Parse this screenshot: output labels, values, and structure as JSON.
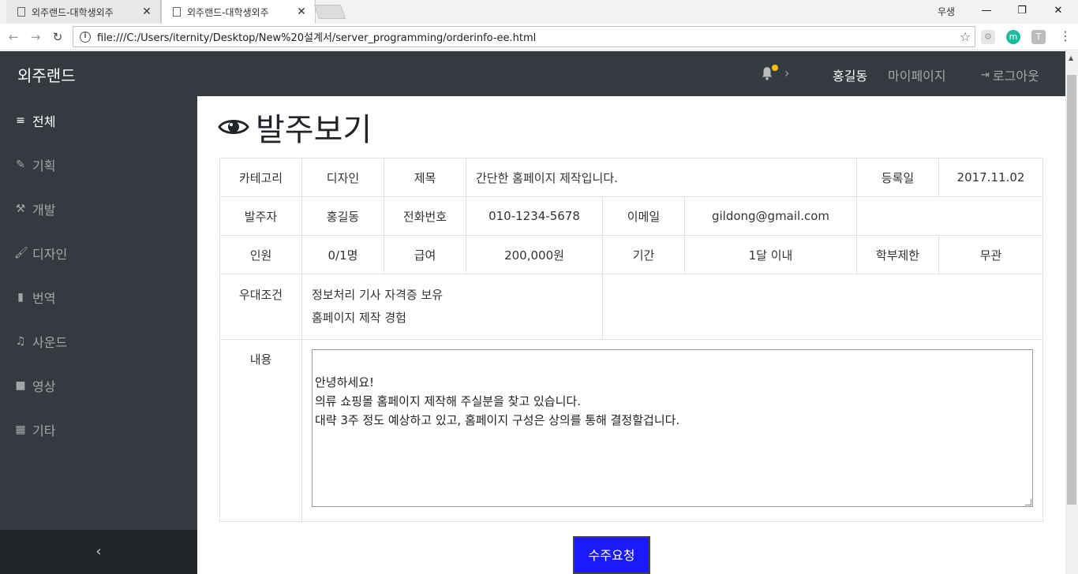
{
  "browser": {
    "tabs": [
      {
        "title": "외주랜드-대학생외주",
        "close": "✕"
      },
      {
        "title": "외주랜드-대학생외주",
        "close": "✕"
      }
    ],
    "profile": "우생",
    "window_controls": {
      "minimize": "—",
      "restore": "❐",
      "close": "✕"
    },
    "url": "file:///C:/Users/iternity/Desktop/New%20설계서/server_programming/orderinfo-ee.html",
    "extensions": [
      "m",
      "T"
    ]
  },
  "topbar": {
    "brand": "외주랜드",
    "user": "홍길동",
    "mypage": "마이페이지",
    "logout": "로그아웃",
    "chevron": "›"
  },
  "sidebar": {
    "items": [
      {
        "icon": "list-icon",
        "glyph": "≡",
        "label": "전체"
      },
      {
        "icon": "pencil-icon",
        "glyph": "✎",
        "label": "기획"
      },
      {
        "icon": "wrench-icon",
        "glyph": "⚒",
        "label": "개발"
      },
      {
        "icon": "brush-icon",
        "glyph": "🖌",
        "label": "디자인"
      },
      {
        "icon": "file-icon",
        "glyph": "▮",
        "label": "번역"
      },
      {
        "icon": "music-icon",
        "glyph": "♫",
        "label": "사운드"
      },
      {
        "icon": "video-icon",
        "glyph": "■",
        "label": "영상"
      },
      {
        "icon": "table-icon",
        "glyph": "▦",
        "label": "기타"
      }
    ],
    "toggle": "‹"
  },
  "content": {
    "title": "발주보기",
    "info": {
      "category_label": "카테고리",
      "category_value": "디자인",
      "subject_label": "제목",
      "subject_value": "간단한 홈페이지 제작입니다.",
      "regdate_label": "등록일",
      "regdate_value": "2017.11.02",
      "client_label": "발주자",
      "client_value": "홍길동",
      "phone_label": "전화번호",
      "phone_value": "010-1234-5678",
      "email_label": "이메일",
      "email_value": "gildong@gmail.com",
      "headcount_label": "인원",
      "headcount_value": "0/1명",
      "pay_label": "급여",
      "pay_value": "200,000원",
      "period_label": "기간",
      "period_value": "1달 이내",
      "major_label": "학부제한",
      "major_value": "무관",
      "prefs_label": "우대조건",
      "prefs": [
        "정보처리 기사 자격증 보유",
        "홈페이지 제작 경험"
      ],
      "content_label": "내용",
      "content_value": "안녕하세요!\n의류 쇼핑몰 홈페이지 제작해 주실분을 찾고 있습니다.\n대략 3주 정도 예상하고 있고, 홈페이지 구성은 상의를 통해 결정할겁니다."
    },
    "submit": "수주요청"
  },
  "colors": {
    "sidebar": "#343a40",
    "button": "#1a1aff",
    "notification": "#ffc107"
  }
}
